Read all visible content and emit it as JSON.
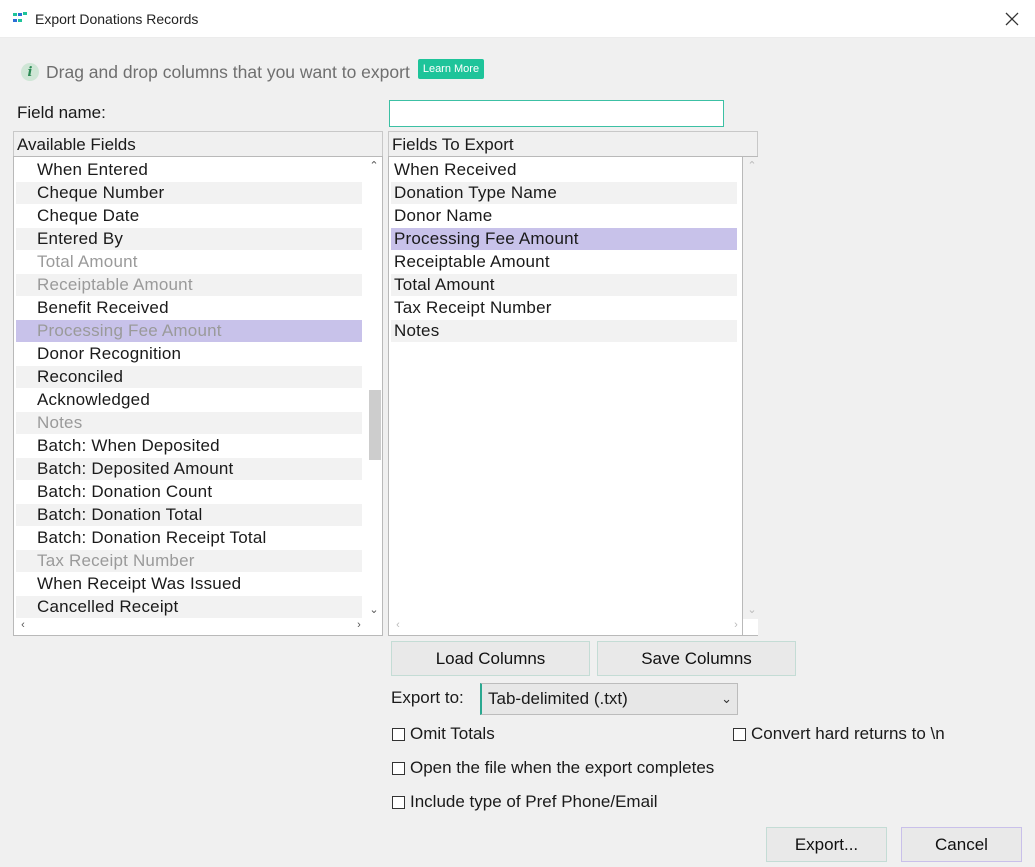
{
  "window": {
    "title": "Export Donations Records",
    "app_icon": "app-logo-icon",
    "close_icon": "close-icon"
  },
  "info": {
    "icon": "info-icon",
    "text": "Drag and drop columns that you want to export",
    "learn_more": "Learn More"
  },
  "field_name": {
    "label": "Field name:",
    "value": "",
    "placeholder": ""
  },
  "available": {
    "header": "Available Fields",
    "items": [
      {
        "label": "When Entered",
        "state": "normal"
      },
      {
        "label": "Cheque Number",
        "state": "normal"
      },
      {
        "label": "Cheque Date",
        "state": "normal"
      },
      {
        "label": "Entered By",
        "state": "normal"
      },
      {
        "label": "Total Amount",
        "state": "dim"
      },
      {
        "label": "Receiptable Amount",
        "state": "dim"
      },
      {
        "label": "Benefit Received",
        "state": "normal"
      },
      {
        "label": "Processing Fee Amount",
        "state": "selected-dim"
      },
      {
        "label": "Donor Recognition",
        "state": "normal"
      },
      {
        "label": "Reconciled",
        "state": "normal"
      },
      {
        "label": "Acknowledged",
        "state": "normal"
      },
      {
        "label": "Notes",
        "state": "dim"
      },
      {
        "label": "Batch: When Deposited",
        "state": "normal"
      },
      {
        "label": "Batch: Deposited Amount",
        "state": "normal"
      },
      {
        "label": "Batch: Donation Count",
        "state": "normal"
      },
      {
        "label": "Batch: Donation Total",
        "state": "normal"
      },
      {
        "label": "Batch: Donation Receipt Total",
        "state": "normal"
      },
      {
        "label": "Tax Receipt Number",
        "state": "dim"
      },
      {
        "label": "When Receipt Was Issued",
        "state": "normal"
      },
      {
        "label": "Cancelled Receipt",
        "state": "normal"
      }
    ]
  },
  "export_fields": {
    "header": "Fields To Export",
    "items": [
      {
        "label": "When Received",
        "state": "normal"
      },
      {
        "label": "Donation Type Name",
        "state": "normal"
      },
      {
        "label": "Donor Name",
        "state": "normal"
      },
      {
        "label": "Processing Fee Amount",
        "state": "selected"
      },
      {
        "label": "Receiptable Amount",
        "state": "normal"
      },
      {
        "label": "Total Amount",
        "state": "normal"
      },
      {
        "label": "Tax Receipt Number",
        "state": "normal"
      },
      {
        "label": "Notes",
        "state": "normal"
      }
    ]
  },
  "buttons": {
    "load_columns": "Load Columns",
    "save_columns": "Save Columns",
    "export": "Export...",
    "cancel": "Cancel"
  },
  "export_to": {
    "label": "Export to:",
    "value": "Tab-delimited (.txt)"
  },
  "options": {
    "omit_totals": {
      "label": "Omit Totals",
      "checked": false
    },
    "convert_returns": {
      "label": "Convert hard returns to \\n",
      "checked": false
    },
    "open_file": {
      "label": "Open the file when the export completes",
      "checked": false
    },
    "include_pref": {
      "label": "Include type of Pref Phone/Email",
      "checked": false
    }
  },
  "colors": {
    "accent": "#1ec49a",
    "selection": "#c8c2ea",
    "input_border": "#3cc0a4"
  }
}
